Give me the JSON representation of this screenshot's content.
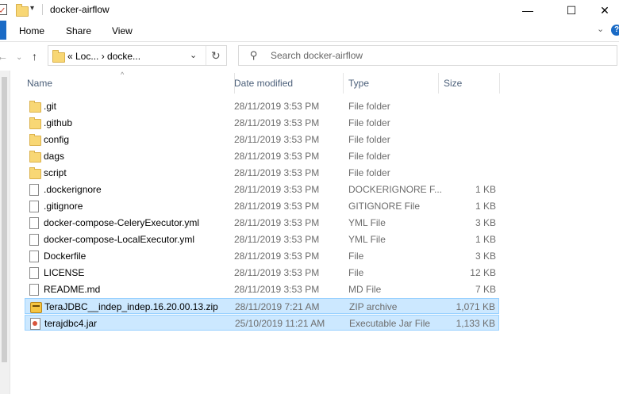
{
  "window": {
    "title": "docker-airflow",
    "minimize_glyph": "—",
    "maximize_glyph": "☐",
    "close_glyph": "✕"
  },
  "ribbon": {
    "tabs": [
      "Home",
      "Share",
      "View"
    ],
    "expand_glyph": "⌄",
    "help_glyph": "?"
  },
  "nav": {
    "back_glyph": "←",
    "forward_glyph": "→",
    "up_glyph": "↑",
    "breadcrumb": "«  Loc...  ›  docke...",
    "dropdown_glyph": "⌄",
    "refresh_glyph": "↻"
  },
  "search": {
    "placeholder": "Search docker-airflow",
    "icon_glyph": "⚲"
  },
  "columns": {
    "sort_glyph": "^",
    "name": "Name",
    "date": "Date modified",
    "type": "Type",
    "size": "Size"
  },
  "files": [
    {
      "name": ".git",
      "date": "28/11/2019 3:53 PM",
      "type": "File folder",
      "size": "",
      "icon": "folder-icon",
      "selected": false
    },
    {
      "name": ".github",
      "date": "28/11/2019 3:53 PM",
      "type": "File folder",
      "size": "",
      "icon": "folder-icon",
      "selected": false
    },
    {
      "name": "config",
      "date": "28/11/2019 3:53 PM",
      "type": "File folder",
      "size": "",
      "icon": "folder-icon",
      "selected": false
    },
    {
      "name": "dags",
      "date": "28/11/2019 3:53 PM",
      "type": "File folder",
      "size": "",
      "icon": "folder-icon",
      "selected": false
    },
    {
      "name": "script",
      "date": "28/11/2019 3:53 PM",
      "type": "File folder",
      "size": "",
      "icon": "folder-icon",
      "selected": false
    },
    {
      "name": ".dockerignore",
      "date": "28/11/2019 3:53 PM",
      "type": "DOCKERIGNORE F...",
      "size": "1 KB",
      "icon": "file-icon",
      "selected": false
    },
    {
      "name": ".gitignore",
      "date": "28/11/2019 3:53 PM",
      "type": "GITIGNORE File",
      "size": "1 KB",
      "icon": "file-icon",
      "selected": false
    },
    {
      "name": "docker-compose-CeleryExecutor.yml",
      "date": "28/11/2019 3:53 PM",
      "type": "YML File",
      "size": "3 KB",
      "icon": "file-icon",
      "selected": false
    },
    {
      "name": "docker-compose-LocalExecutor.yml",
      "date": "28/11/2019 3:53 PM",
      "type": "YML File",
      "size": "1 KB",
      "icon": "file-icon",
      "selected": false
    },
    {
      "name": "Dockerfile",
      "date": "28/11/2019 3:53 PM",
      "type": "File",
      "size": "3 KB",
      "icon": "file-icon",
      "selected": false
    },
    {
      "name": "LICENSE",
      "date": "28/11/2019 3:53 PM",
      "type": "File",
      "size": "12 KB",
      "icon": "file-icon",
      "selected": false
    },
    {
      "name": "README.md",
      "date": "28/11/2019 3:53 PM",
      "type": "MD File",
      "size": "7 KB",
      "icon": "file-icon",
      "selected": false
    },
    {
      "name": "TeraJDBC__indep_indep.16.20.00.13.zip",
      "date": "28/11/2019 7:21 AM",
      "type": "ZIP archive",
      "size": "1,071 KB",
      "icon": "zip-icon",
      "selected": true
    },
    {
      "name": "terajdbc4.jar",
      "date": "25/10/2019 11:21 AM",
      "type": "Executable Jar File",
      "size": "1,133 KB",
      "icon": "jar-icon",
      "selected": true
    }
  ]
}
